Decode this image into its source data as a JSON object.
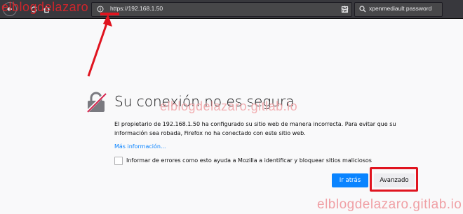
{
  "browser": {
    "url": "https://192.168.1.50",
    "search_text": "xpenmediault password"
  },
  "watermarks": {
    "top": "elblogdelazaro",
    "middle": "elblogdelazaro.gitlab.io",
    "bottom": "elblogdelazaro.gitlab.io"
  },
  "error": {
    "title": "Su conexión no es segura",
    "description": "El propietario de 192.168.1.50 ha configurado su sitio web de manera incorrecta. Para evitar que su información sea robada, Firefox no ha conectado con este sitio web.",
    "more_info": "Más información...",
    "report_checkbox_label": "Informar de errores como esto ayuda a Mozilla a identificar y bloquear sitios maliciosos",
    "back_button": "Ir atrás",
    "advanced_button": "Avanzado"
  },
  "colors": {
    "accent": "#0a84ff",
    "annotation": "#e0141f",
    "toolbar": "#38383d"
  },
  "icons": [
    "back-arrow-icon",
    "reload-icon",
    "home-icon",
    "info-icon",
    "bookmark-star-icon",
    "library-icon",
    "search-icon",
    "broken-lock-icon"
  ]
}
